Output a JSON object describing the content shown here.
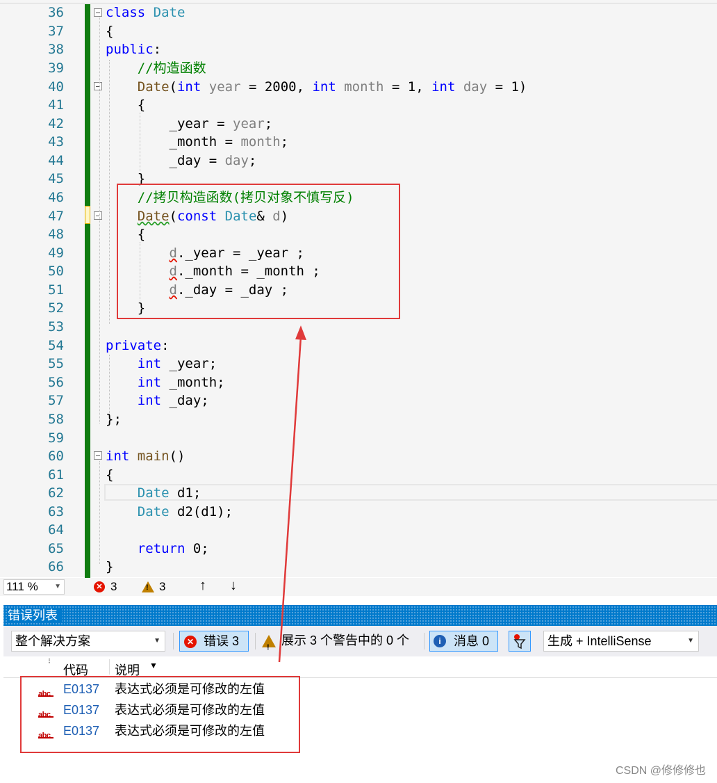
{
  "editor": {
    "line_numbers": [
      "36",
      "37",
      "38",
      "39",
      "40",
      "41",
      "42",
      "43",
      "44",
      "45",
      "46",
      "47",
      "48",
      "49",
      "50",
      "51",
      "52",
      "53",
      "54",
      "55",
      "56",
      "57",
      "58",
      "59",
      "60",
      "61",
      "62",
      "63",
      "64",
      "65",
      "66"
    ],
    "lines": {
      "l36a": "class",
      "l36b": " Date",
      "l37": "{",
      "l38a": "public",
      "l38b": ":",
      "l39": "    //构造函数",
      "l40_fn": "Date",
      "l40_p1": "(",
      "l40_int1": "int",
      "l40_year": " year",
      "l40_v1": " = 2000, ",
      "l40_int2": "int",
      "l40_month": " month",
      "l40_v2": " = 1, ",
      "l40_int3": "int",
      "l40_day": " day",
      "l40_v3": " = 1)",
      "l41": "    {",
      "l42a": "        _year = ",
      "l42b": "year",
      "l42c": ";",
      "l43a": "        _month = ",
      "l43b": "month",
      "l43c": ";",
      "l44a": "        _day = ",
      "l44b": "day",
      "l44c": ";",
      "l45": "    }",
      "l46": "    //拷贝构造函数(拷贝对象不慎写反)",
      "l47_fn": "Date",
      "l47_p1": "(",
      "l47_const": "const",
      "l47_ty": " Date",
      "l47_amp": "& ",
      "l47_d": "d",
      "l47_p2": ")",
      "l48": "    {",
      "l49_d": "d",
      "l49_rest": "._year = _year ;",
      "l50_d": "d",
      "l50_rest": "._month = _month ;",
      "l51_d": "d",
      "l51_rest": "._day = _day ;",
      "l52": "    }",
      "l54a": "private",
      "l54b": ":",
      "l55a": "int",
      "l55b": " _year;",
      "l56a": "int",
      "l56b": " _month;",
      "l57a": "int",
      "l57b": " _day;",
      "l58": "};",
      "l60a": "int",
      "l60b": " main",
      "l60c": "()",
      "l61": "{",
      "l62a": "Date",
      "l62b": " d1;",
      "l63a": "Date",
      "l63b": " d2(d1);",
      "l65a": "return",
      "l65b": " 0;",
      "l66": "}"
    }
  },
  "statusbar": {
    "zoom": "111 %",
    "error_count": "3",
    "warning_count": "3",
    "up_arrow": "↑",
    "down_arrow": "↓"
  },
  "error_list": {
    "title": "错误列表",
    "scope_dropdown": "整个解决方案",
    "errors_button": "错误 3",
    "warnings_button": "展示 3 个警告中的 0 个",
    "messages_button": "消息 0",
    "build_dropdown": "生成 + IntelliSense",
    "columns": {
      "code": "代码",
      "description": "说明"
    },
    "rows": [
      {
        "code": "E0137",
        "description": "表达式必须是可修改的左值"
      },
      {
        "code": "E0137",
        "description": "表达式必须是可修改的左值"
      },
      {
        "code": "E0137",
        "description": "表达式必须是可修改的左值"
      }
    ],
    "error_icon_text": "abc"
  },
  "watermark": "CSDN @修修修也",
  "colors": {
    "keyword": "#0000ff",
    "type": "#2b91af",
    "comment": "#008000",
    "param": "#808080",
    "highlight_box": "#e03a3a",
    "change_bar": "#107c10",
    "error_list_title": "#007acc"
  }
}
